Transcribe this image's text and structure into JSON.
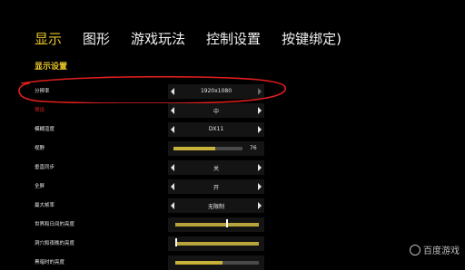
{
  "tabs": [
    "显示",
    "图形",
    "游戏玩法",
    "控制设置",
    "按键绑定)"
  ],
  "active_tab": "显示",
  "section_title": "显示设置",
  "settings": {
    "resolution": {
      "label": "分辨率",
      "value": "1920x1080"
    },
    "preset": {
      "label": "预设",
      "value": "中"
    },
    "render_mode": {
      "label": "模糊渲度",
      "value": "DX11"
    },
    "fov": {
      "label": "视野",
      "value": "76"
    },
    "vsync": {
      "label": "垂直同步",
      "value": "关"
    },
    "fullscreen": {
      "label": "全屏",
      "value": "开"
    },
    "max_fps": {
      "label": "最大帧率",
      "value": "无限制"
    },
    "world_brightness": {
      "label": "世界和日间的亮度",
      "level": 0.62
    },
    "cave_brightness": {
      "label": "洞穴和夜晚的亮度",
      "level": 0.02
    },
    "extra": {
      "label": "黑暗时的亮度"
    }
  },
  "watermark": {
    "text": "百度游戏"
  },
  "colors": {
    "accent": "#e7c32a",
    "annotation": "#e01e1e"
  }
}
